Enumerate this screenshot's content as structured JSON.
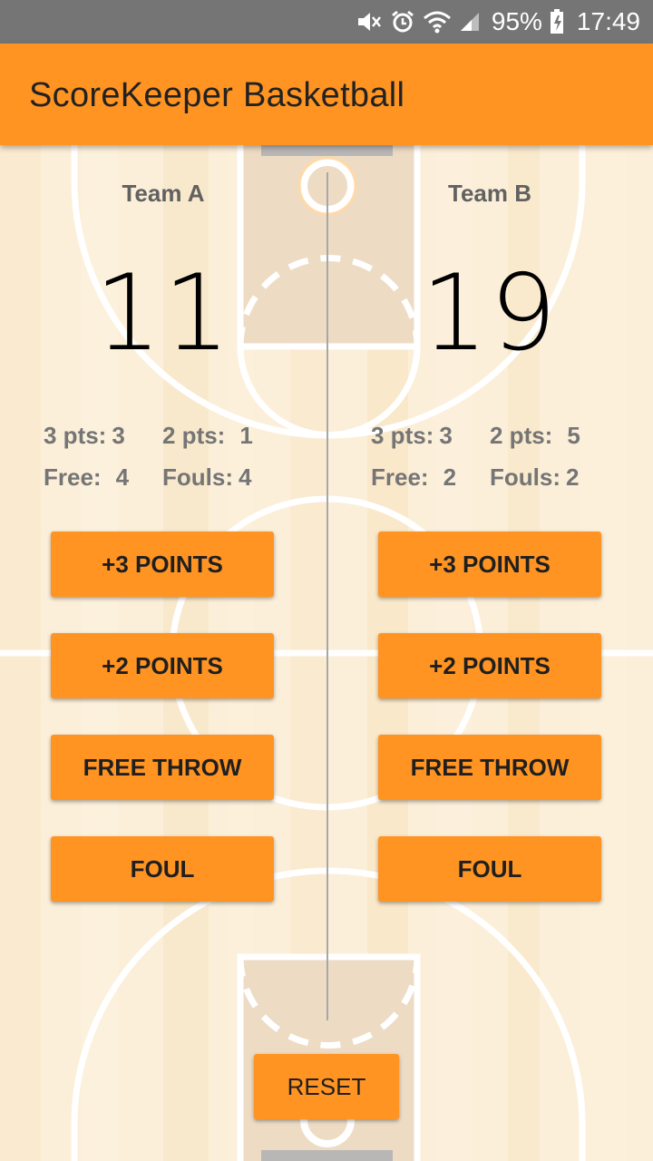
{
  "status_bar": {
    "battery_percent": "95%",
    "time": "17:49",
    "icons": [
      "mute-icon",
      "alarm-icon",
      "wifi-icon",
      "signal-icon",
      "battery-charging-icon"
    ]
  },
  "app_bar": {
    "title": "ScoreKeeper Basketball"
  },
  "team_a": {
    "name": "Team A",
    "score": "11",
    "three_pts_label": "3 pts:",
    "three_pts_value": "3",
    "two_pts_label": "2 pts:",
    "two_pts_value": "1",
    "free_label": "Free:",
    "free_value": "4",
    "fouls_label": "Fouls:",
    "fouls_value": "4"
  },
  "team_b": {
    "name": "Team B",
    "score": "19",
    "three_pts_label": "3 pts:",
    "three_pts_value": "3",
    "two_pts_label": "2 pts:",
    "two_pts_value": "5",
    "free_label": "Free:",
    "free_value": "2",
    "fouls_label": "Fouls:",
    "fouls_value": "2"
  },
  "buttons": {
    "plus_three": "+3 POINTS",
    "plus_two": "+2 POINTS",
    "free_throw": "FREE THROW",
    "foul": "FOUL",
    "reset": "RESET"
  },
  "colors": {
    "accent": "#ff9423",
    "status_bar": "#757575",
    "court_floor": "#fcefd9",
    "court_lines": "#ffffff"
  }
}
